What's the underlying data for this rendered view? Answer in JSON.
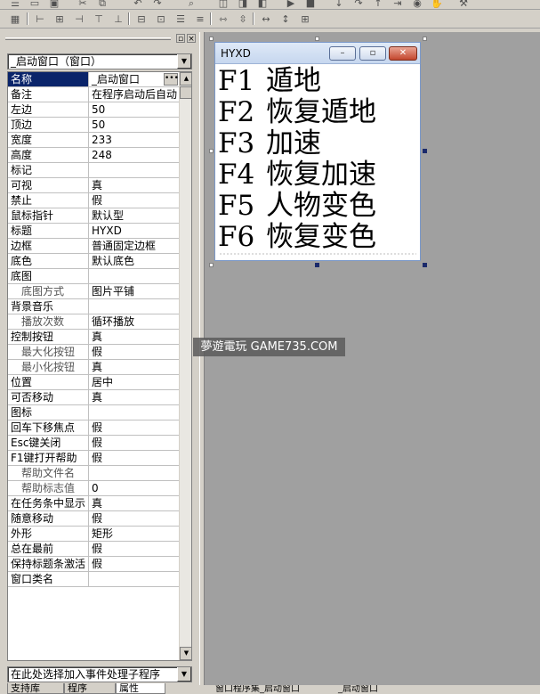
{
  "object_selector": {
    "value": "_启动窗口（窗口）"
  },
  "properties": [
    {
      "name": "名称",
      "value": "_启动窗口",
      "selected": true,
      "has_ellipsis": true
    },
    {
      "name": "备注",
      "value": "在程序启动后自动"
    },
    {
      "name": "左边",
      "value": "50"
    },
    {
      "name": "顶边",
      "value": "50"
    },
    {
      "name": "宽度",
      "value": "233"
    },
    {
      "name": "高度",
      "value": "248"
    },
    {
      "name": "标记",
      "value": ""
    },
    {
      "name": "可视",
      "value": "真"
    },
    {
      "name": "禁止",
      "value": "假"
    },
    {
      "name": "鼠标指针",
      "value": "默认型"
    },
    {
      "name": "标题",
      "value": "HYXD"
    },
    {
      "name": "边框",
      "value": "普通固定边框"
    },
    {
      "name": "底色",
      "value": "默认底色"
    },
    {
      "name": "底图",
      "value": ""
    },
    {
      "name": "底图方式",
      "value": "图片平铺",
      "sub": true
    },
    {
      "name": "背景音乐",
      "value": ""
    },
    {
      "name": "播放次数",
      "value": "循环播放",
      "sub": true
    },
    {
      "name": "控制按钮",
      "value": "真"
    },
    {
      "name": "最大化按钮",
      "value": "假",
      "sub": true
    },
    {
      "name": "最小化按钮",
      "value": "真",
      "sub": true
    },
    {
      "name": "位置",
      "value": "居中"
    },
    {
      "name": "可否移动",
      "value": "真"
    },
    {
      "name": "图标",
      "value": ""
    },
    {
      "name": "回车下移焦点",
      "value": "假"
    },
    {
      "name": "Esc键关闭",
      "value": "假"
    },
    {
      "name": "F1键打开帮助",
      "value": "假"
    },
    {
      "name": "帮助文件名",
      "value": "",
      "sub": true
    },
    {
      "name": "帮助标志值",
      "value": "0",
      "sub": true
    },
    {
      "name": "在任务条中显示",
      "value": "真"
    },
    {
      "name": "随意移动",
      "value": "假"
    },
    {
      "name": "外形",
      "value": "矩形"
    },
    {
      "name": "总在最前",
      "value": "假"
    },
    {
      "name": "保持标题条激活",
      "value": "假"
    },
    {
      "name": "窗口类名",
      "value": ""
    }
  ],
  "event_selector": {
    "value": "在此处选择加入事件处理子程序"
  },
  "panel_tabs": [
    "支持库",
    "程序",
    "属性"
  ],
  "editor_tabs": [
    "窗口程序集_启动窗口",
    "_启动窗口"
  ],
  "preview_window": {
    "title": "HYXD",
    "hotkeys": [
      {
        "key": "F1",
        "label": "遁地"
      },
      {
        "key": "F2",
        "label": "恢复遁地"
      },
      {
        "key": "F3",
        "label": "加速"
      },
      {
        "key": "F4",
        "label": "恢复加速"
      },
      {
        "key": "F5",
        "label": "人物变色"
      },
      {
        "key": "F6",
        "label": "恢复变色"
      }
    ]
  },
  "watermark": "夢遊電玩 GAME735.COM",
  "colors": {
    "selected_row": "#0a246a",
    "design_bg": "#a0a0a0",
    "panel_bg": "#d4d0c8"
  }
}
